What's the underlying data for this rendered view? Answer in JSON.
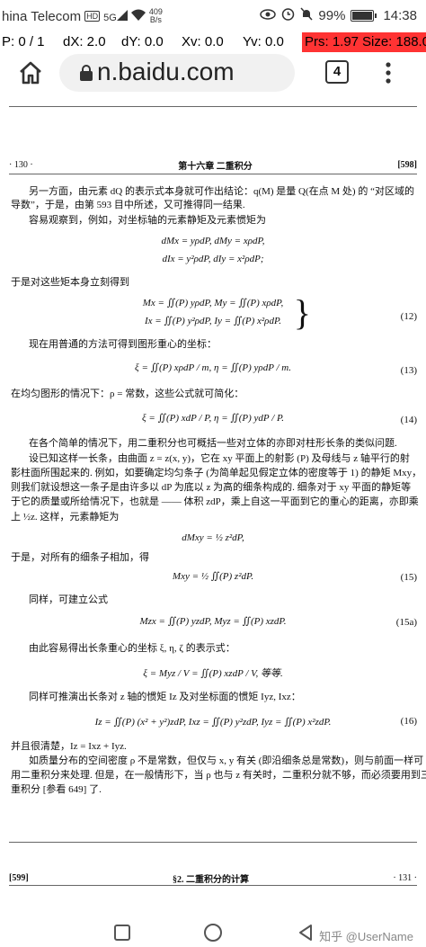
{
  "status_bar": {
    "carrier": "hina Telecom",
    "network_badge": "HD",
    "signal": "5G",
    "net_speed_value": "409",
    "net_speed_unit": "B/s",
    "battery": "99%",
    "time": "14:38"
  },
  "pointer_location": {
    "p": "P: 0 / 1",
    "dx": "dX: 2.0",
    "dy": "dY: 0.0",
    "xv": "Xv: 0.0",
    "yv": "Yv: 0.0",
    "prs": "Prs: 1.97",
    "size": "Size: 188.0"
  },
  "browser": {
    "url": "n.baidu.com",
    "tab_count": "4"
  },
  "page_top": {
    "page_left": "· 130 ·",
    "chapter": "第十六章  二重积分",
    "page_right": "[598]"
  },
  "body": {
    "l1": "另一方面，由元素 dQ 的表示式本身就可作出结论：q(M) 是量 Q(在点 M 处) 的 “对区域的",
    "l2": "导数”，于是，由第 593 目中所述，又可推得同一结果.",
    "l3": "容易观察到，例如，对坐标轴的元素静矩及元素惯矩为",
    "eq1a": "dMx = yρdP,   dMy = xρdP,",
    "eq1b": "dIx = y²ρdP,   dIy = x²ρdP;",
    "l4": "于是对这些矩本身立刻得到",
    "eq12a": "Mx = ∬(P) yρdP,    My = ∬(P) xρdP,",
    "eq12b": "Ix = ∬(P) y²ρdP,    Iy = ∬(P) x²ρdP.",
    "n12": "(12)",
    "l5": "现在用普通的方法可得到图形重心的坐标：",
    "eq13": "ξ = ∬(P) xρdP / m,    η = ∬(P) yρdP / m.",
    "n13": "(13)",
    "l6": "在均匀图形的情况下：ρ = 常数，这些公式就可简化：",
    "eq14": "ξ = ∬(P) xdP / P,    η = ∬(P) ydP / P.",
    "n14": "(14)",
    "l7": "在各个简单的情况下，用二重积分也可概括一些对立体的亦即对柱形长条的类似问题.",
    "l8": "设已知这样一长条，由曲面 z = z(x, y)，它在 xy 平面上的射影 (P) 及母线与 z 轴平行的射",
    "l9": "影柱面所围起来的. 例如，如要确定均匀条子 (为简单起见假定立体的密度等于 1) 的静矩 Mxy，",
    "l10": "则我们就设想这一条子是由许多以 dP 为底以 z 为高的细条构成的. 细条对于 xy 平面的静矩等",
    "l11": "于它的质量或所给情况下，也就是 —— 体积 zdP，乘上自这一平面到它的重心的距离，亦即乘",
    "l12": "上 ½z. 这样，元素静矩为",
    "eq_dm": "dMxy = ½ z²dP,",
    "l13": "于是，对所有的细条子相加，得",
    "eq15": "Mxy = ½ ∬(P) z²dP.",
    "n15": "(15)",
    "l14": "同样，可建立公式",
    "eq15a": "Mzx = ∬(P) yzdP,    Myz = ∬(P) xzdP.",
    "n15a": "(15a)",
    "l15": "由此容易得出长条重心的坐标 ξ, η, ζ 的表示式：",
    "eq_xi": "ξ = Myz / V = ∬(P) xzdP / V,  等等.",
    "l16": "同样可推演出长条对 z 轴的惯矩 Iz 及对坐标面的惯矩 Iyz, Ixz：",
    "eq16": "Iz = ∬(P) (x² + y²)zdP,    Ixz = ∬(P) y²zdP,    Iyz = ∬(P) x²zdP.",
    "n16": "(16)",
    "l17": "并且很清楚，Iz = Ixz + Iyz.",
    "l18": "如质量分布的空间密度 ρ 不是常数，但仅与 x, y 有关 (即沿细条总是常数)，则与前面一样可",
    "l19": "用二重积分来处理. 但是，在一般情形下，当 ρ 也与 z 有关时，二重积分就不够，而必须要用到三",
    "l20": "重积分 [参看 649] 了."
  },
  "page_bottom": {
    "page_left": "[599]",
    "section": "§2. 二重积分的计算",
    "page_right": "· 131 ·"
  },
  "watermark": "知乎 @UserName"
}
